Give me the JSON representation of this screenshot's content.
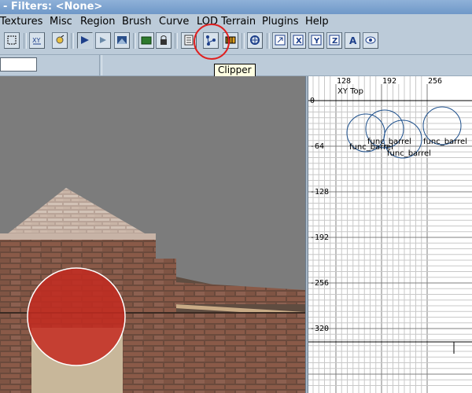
{
  "app": {
    "title": "- Filters: <None>"
  },
  "menu": {
    "items": [
      "Textures",
      "Misc",
      "Region",
      "Brush",
      "Curve",
      "LOD Terrain",
      "Plugins",
      "Help"
    ]
  },
  "toolbar": {
    "buttons": [
      "select-icon",
      "flip-xy-icon",
      "rotate-icon",
      "texture-lock-icon",
      "camera-icon",
      "region-icon",
      "entity-icon",
      "lock-icon",
      "list-icon",
      "clipper-icon",
      "bbox-icon",
      "patch-icon",
      "scale-icon",
      "x-axis-icon",
      "y-axis-icon",
      "z-axis-icon",
      "align-icon",
      "eye-icon"
    ],
    "x_label": "X",
    "y_label": "Y",
    "z_label": "Z",
    "a_label": "A",
    "xy_label": "XY"
  },
  "filter": {
    "value": ""
  },
  "tooltip": {
    "text": "Clipper"
  },
  "grid": {
    "view_label": "XY Top",
    "x_ticks": [
      "128",
      "192",
      "256"
    ],
    "y_ticks": [
      "0",
      "-64",
      "-128",
      "-192",
      "-256",
      "-320"
    ],
    "entities": [
      "func_barrel",
      "func_barrel",
      "func_barrel",
      "func_barrel"
    ]
  },
  "colors": {
    "accent": "#e02020",
    "titlebar": "#7aa3d3",
    "entity_circle": "#1c4f8c",
    "ruler_label": "#8a2b8a"
  }
}
